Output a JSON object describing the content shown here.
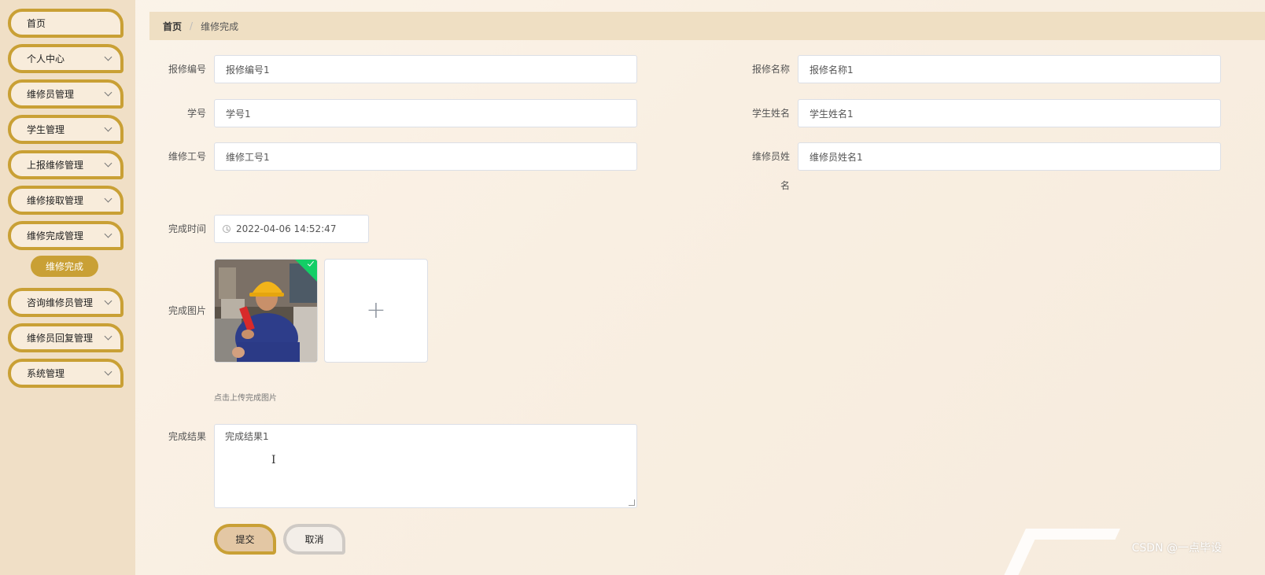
{
  "sidebar": {
    "items": [
      {
        "label": "首页",
        "has_arrow": false
      },
      {
        "label": "个人中心",
        "has_arrow": true
      },
      {
        "label": "维修员管理",
        "has_arrow": true
      },
      {
        "label": "学生管理",
        "has_arrow": true
      },
      {
        "label": "上报维修管理",
        "has_arrow": true
      },
      {
        "label": "维修接取管理",
        "has_arrow": true
      },
      {
        "label": "维修完成管理",
        "has_arrow": true
      },
      {
        "label": "咨询维修员管理",
        "has_arrow": true
      },
      {
        "label": "维修员回复管理",
        "has_arrow": true
      },
      {
        "label": "系统管理",
        "has_arrow": true
      }
    ],
    "active_subitem": "维修完成"
  },
  "breadcrumb": {
    "home": "首页",
    "separator": "/",
    "current": "维修完成"
  },
  "form": {
    "repair_no": {
      "label": "报修编号",
      "value": "报修编号1"
    },
    "repair_name": {
      "label": "报修名称",
      "value": "报修名称1"
    },
    "student_no": {
      "label": "学号",
      "value": "学号1"
    },
    "student_name": {
      "label": "学生姓名",
      "value": "学生姓名1"
    },
    "worker_no": {
      "label": "维修工号",
      "value": "维修工号1"
    },
    "worker_name": {
      "label_line1": "维修员姓",
      "label_line2": "名",
      "value": "维修员姓名1"
    },
    "finish_time": {
      "label": "完成时间",
      "value": "2022-04-06 14:52:47"
    },
    "finish_image": {
      "label": "完成图片",
      "tip": "点击上传完成图片",
      "plus": "+"
    },
    "finish_result": {
      "label": "完成结果",
      "value": "完成结果1"
    },
    "text_cursor": "I"
  },
  "buttons": {
    "submit": "提交",
    "cancel": "取消"
  },
  "watermark": "CSDN @一点毕设",
  "colors": {
    "accent": "#c9a035",
    "sidebar_bg": "#f0dfc6",
    "breadcrumb_bg": "#efdfc3",
    "success": "#13ce66"
  }
}
